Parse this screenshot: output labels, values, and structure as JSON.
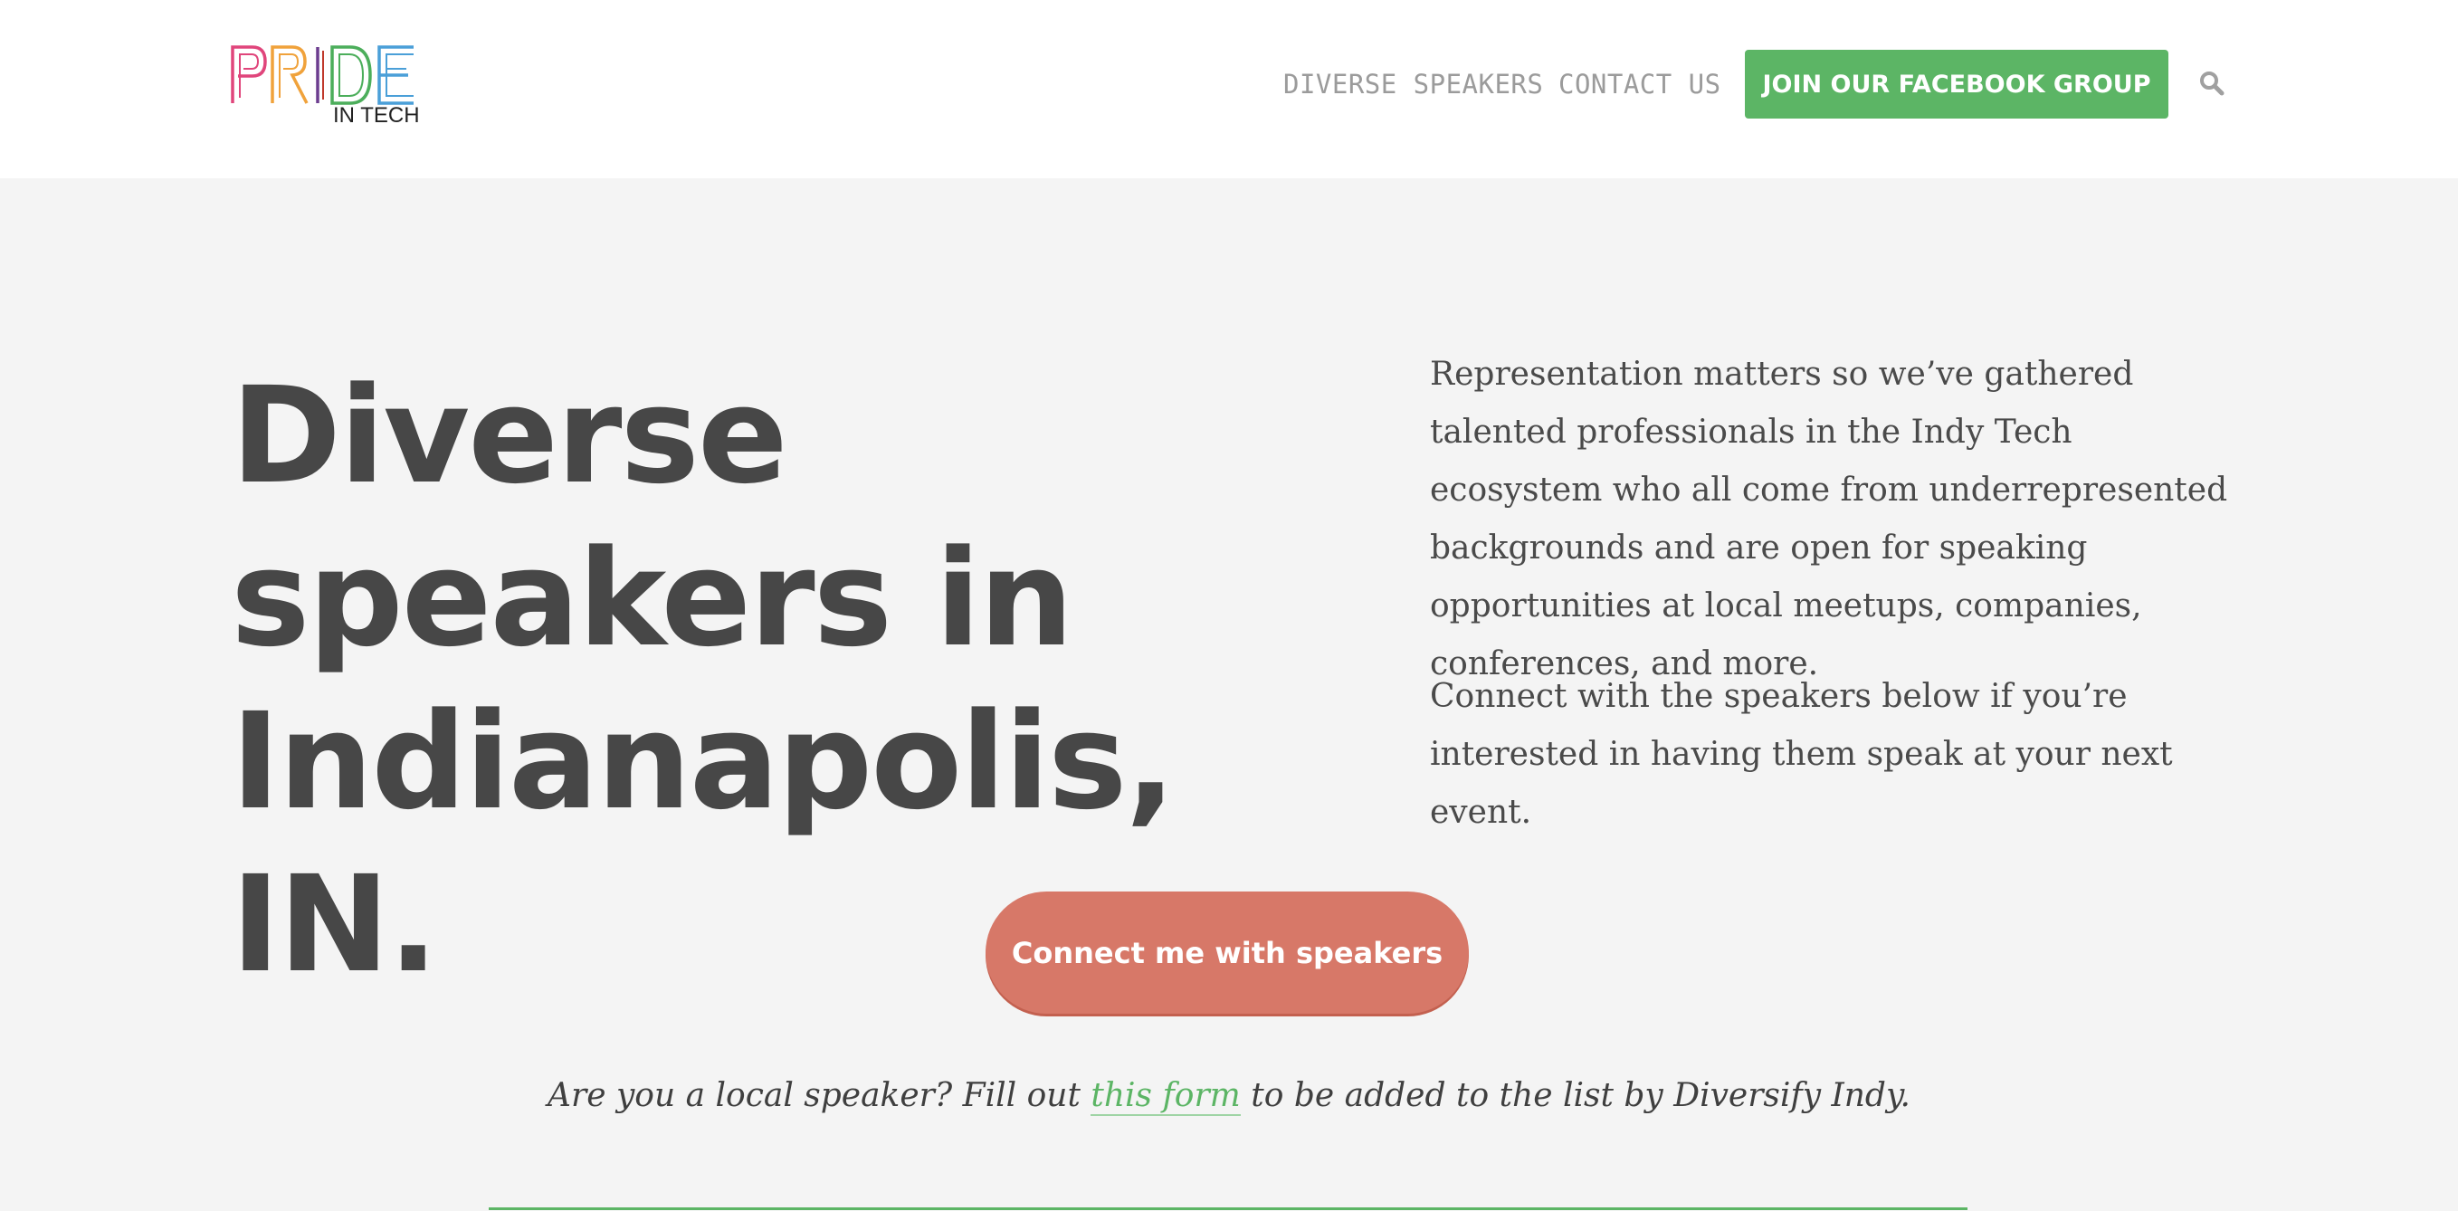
{
  "header": {
    "logo_word": "PRIDE",
    "logo_tagline": "IN TECH",
    "nav": [
      {
        "label": "DIVERSE SPEAKERS"
      },
      {
        "label": "CONTACT US"
      }
    ],
    "cta_label": "JOIN OUR FACEBOOK GROUP",
    "search_icon": "search-icon"
  },
  "hero": {
    "title": "Diverse speakers in Indianapolis, IN.",
    "intro_1": "Representation matters so we’ve gathered talented professionals in the Indy Tech ecosystem who all come from underrepresented backgrounds and are open for speaking opportunities at local meetups, companies, conferences, and more.",
    "intro_2": "Connect with the speakers below if you’re interested in having them speak at your next event.",
    "cta_label": "Connect me with speakers"
  },
  "note": {
    "before": "Are you a local speaker? Fill out ",
    "link": "this form",
    "after": " to be added to the list by Diversify Indy."
  },
  "colors": {
    "accent_green": "#5cb565",
    "cta_coral": "#d77868",
    "text_dark": "#474747",
    "nav_gray": "#9b9b9b",
    "background": "#f4f4f4",
    "logo_pink": "#e0457b",
    "logo_orange": "#f0a23b",
    "logo_purple": "#6c3d8f",
    "logo_green": "#4cae5b",
    "logo_blue": "#4a9fd8"
  }
}
